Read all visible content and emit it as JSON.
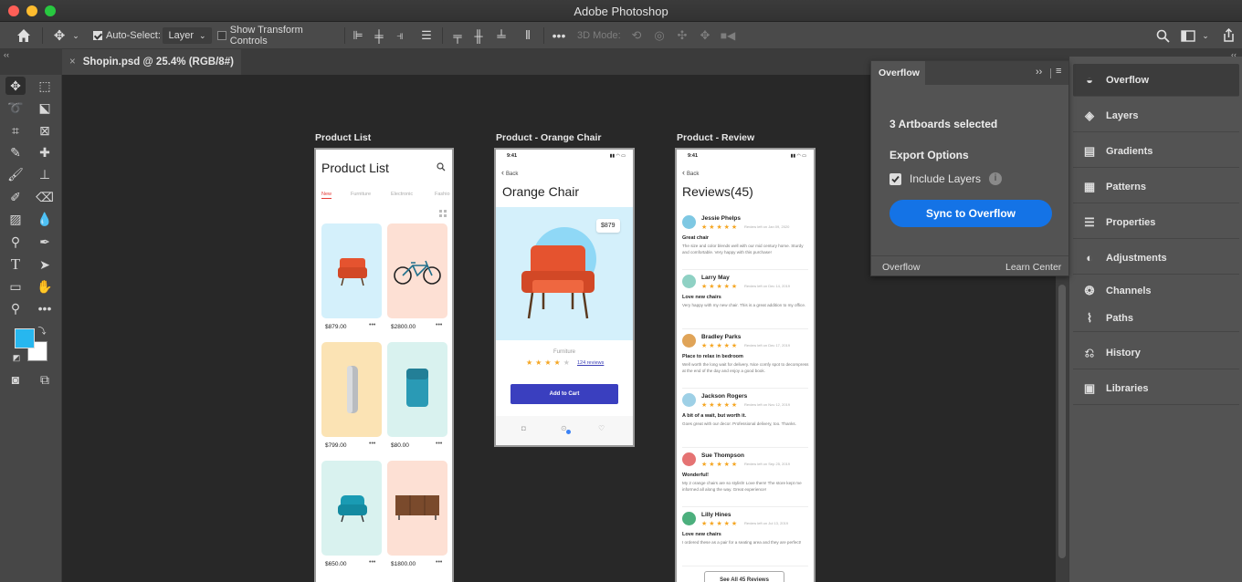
{
  "window": {
    "title": "Adobe Photoshop"
  },
  "options": {
    "auto_select_label": "Auto-Select:",
    "auto_select_value": "Layer",
    "transform_label": "Show Transform Controls",
    "mode_3d_label": "3D Mode:"
  },
  "document": {
    "tab_title": "Shopin.psd @ 25.4% (RGB/8#)"
  },
  "colors": {
    "foreground": "#27b7ef",
    "background": "#ffffff",
    "accent": "#1473e6"
  },
  "artboards": {
    "list": {
      "title": "Product List",
      "heading": "Product List",
      "tabs": [
        "New",
        "Furniture",
        "Electronic",
        "Fashio"
      ],
      "products": [
        {
          "price": "$879.00",
          "item": "orange armchair"
        },
        {
          "price": "$2800.00",
          "item": "bicycle"
        },
        {
          "price": "$799.00",
          "item": "silver speaker"
        },
        {
          "price": "$80.00",
          "item": "teal backpack"
        },
        {
          "price": "$650.00",
          "item": "teal armchair"
        },
        {
          "price": "$1800.00",
          "item": "wooden dresser"
        }
      ]
    },
    "chair": {
      "title": "Product - Orange Chair",
      "time": "9:41",
      "back": "Back",
      "heading": "Orange Chair",
      "price_badge": "$879",
      "category": "Furniture",
      "reviews_link": "124 reviews",
      "rating": 4,
      "cta": "Add to Cart"
    },
    "review": {
      "title": "Product - Review",
      "time": "9:41",
      "back": "Back",
      "heading": "Reviews(45)",
      "reviews": [
        {
          "name": "Jessie Phelps",
          "date": "Review left on Jan 09, 2020",
          "headline": "Great chair",
          "body": "The size and color blends well with our mid century home. Sturdy and comfortable. Very happy with this purchase!",
          "avatar": "#7ec8e3"
        },
        {
          "name": "Larry May",
          "date": "Review left on Dec 14, 2019",
          "headline": "Love new chairs",
          "body": "Very happy with my new chair. This is a great addition to my office.",
          "avatar": "#8fd1c4"
        },
        {
          "name": "Bradley Parks",
          "date": "Review left on Dec 17, 2019",
          "headline": "Place to relax in bedroom",
          "body": "Well worth the long wait for delivery. Nice comfy spot to decompress at the end of the day and enjoy a good book.",
          "avatar": "#e0a458"
        },
        {
          "name": "Jackson Rogers",
          "date": "Review left on Nov 12, 2019",
          "headline": "A bit of a wait, but worth it.",
          "body": "Goes great with our decor. Professional delivery, too. Thanks.",
          "avatar": "#9ed0e6"
        },
        {
          "name": "Sue Thompson",
          "date": "Review left on Sep 25, 2019",
          "headline": "Wonderful!",
          "body": "My 2 orange chairs are so stylish! Love them! The store kept me informed all along the way. Great experience!",
          "avatar": "#e57373"
        },
        {
          "name": "Lilly Hines",
          "date": "Review left on Jul 13, 2019",
          "headline": "Love new chairs",
          "body": "I ordered these as a pair for a seating area and they are perfect!",
          "avatar": "#4caf7d"
        }
      ],
      "see_all": "See All 45 Reviews"
    }
  },
  "overflow_panel": {
    "tab": "Overflow",
    "selected": "3 Artboards selected",
    "export_heading": "Export Options",
    "include_layers": "Include Layers",
    "sync_button": "Sync to Overflow",
    "footer_left": "Overflow",
    "footer_right": "Learn Center"
  },
  "panels": [
    {
      "label": "Overflow",
      "icon": "overflow-icon",
      "glyph": "◒"
    },
    {
      "label": "Layers",
      "icon": "layers-icon",
      "glyph": "◈"
    },
    {
      "label": "Gradients",
      "icon": "gradients-icon",
      "glyph": "▤"
    },
    {
      "label": "Patterns",
      "icon": "patterns-icon",
      "glyph": "▦"
    },
    {
      "label": "Properties",
      "icon": "properties-icon",
      "glyph": "☰"
    },
    {
      "label": "Adjustments",
      "icon": "adjustments-icon",
      "glyph": "◐"
    },
    {
      "label": "Channels",
      "icon": "channels-icon",
      "glyph": "❂"
    },
    {
      "label": "Paths",
      "icon": "paths-icon",
      "glyph": "⌇"
    },
    {
      "label": "History",
      "icon": "history-icon",
      "glyph": "⎌"
    },
    {
      "label": "Libraries",
      "icon": "libraries-icon",
      "glyph": "▣"
    }
  ]
}
